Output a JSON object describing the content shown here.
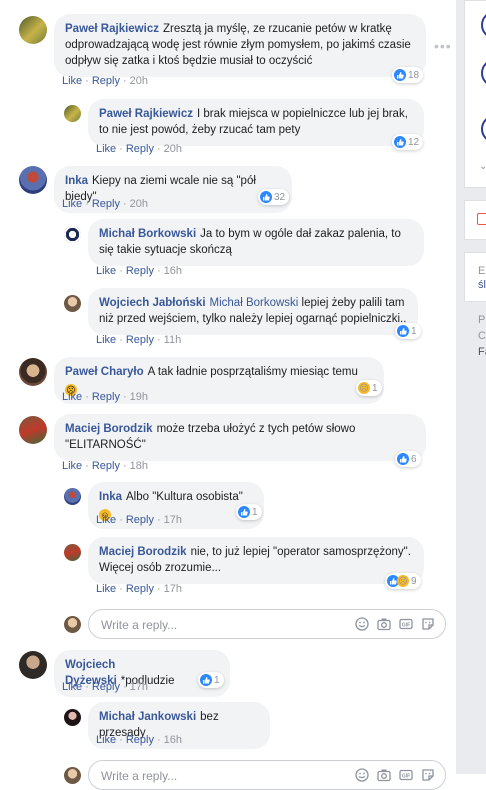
{
  "comments": [
    {
      "author": "Paweł Rajkiewicz",
      "text": "Zresztą ja myślę, ze rzucanie petów w kratkę odprowadzającą wodę jest równie złym pomysłem, po jakimś czasie odpływ się zatka i ktoś będzie musiał to oczyścić",
      "like": "Like",
      "reply": "Reply",
      "time": "20h",
      "count": "18"
    },
    {
      "author": "Paweł Rajkiewicz",
      "text": "I brak miejsca w popielniczce lub jej brak, to nie jest powód, żeby rzucać tam pety",
      "like": "Like",
      "reply": "Reply",
      "time": "20h",
      "count": "12"
    },
    {
      "author": "Inka",
      "text": "Kiepy na ziemi wcale nie są \"pół biedy\"",
      "like": "Like",
      "reply": "Reply",
      "time": "20h",
      "count": "32"
    },
    {
      "author": "Michał Borkowski",
      "text": "Ja to bym w ogóle dał zakaz palenia, to się takie sytuacje skończą",
      "like": "Like",
      "reply": "Reply",
      "time": "16h"
    },
    {
      "author": "Wojciech Jabłoński",
      "mention": "Michał Borkowski",
      "text": "lepiej żeby palili tam niż przed wejściem, tylko należy lepiej ogarnąć popielniczki..",
      "like": "Like",
      "reply": "Reply",
      "time": "11h",
      "count": "1"
    },
    {
      "author": "Paweł Charyło",
      "text": "A tak ładnie posprzątaliśmy miesiąc temu",
      "like": "Like",
      "reply": "Reply",
      "time": "19h",
      "count": "1"
    },
    {
      "author": "Maciej Borodzik",
      "text": "może trzeba ułożyć z tych petów słowo \"ELITARNOŚĆ\"",
      "like": "Like",
      "reply": "Reply",
      "time": "18h",
      "count": "6"
    },
    {
      "author": "Inka",
      "text": "Albo \"Kultura osobista\"",
      "like": "Like",
      "reply": "Reply",
      "time": "17h",
      "count": "1"
    },
    {
      "author": "Maciej Borodzik",
      "text": "nie, to już lepiej \"operator samosprzężony\". Więcej osób zrozumie...",
      "like": "Like",
      "reply": "Reply",
      "time": "17h",
      "count": "9"
    },
    {
      "author": "Wojciech Dyżewski",
      "text": "*podludzie",
      "like": "Like",
      "reply": "Reply",
      "time": "17h",
      "count": "1"
    },
    {
      "author": "Michał Jankowski",
      "text": "bez przesady",
      "like": "Like",
      "reply": "Reply",
      "time": "16h"
    }
  ],
  "reply_box": {
    "placeholder": "Write a reply..."
  },
  "sidebar": {
    "snippets": [
      "E",
      "śl",
      "P",
      "C",
      "Fa"
    ]
  },
  "colors": {
    "link": "#385898",
    "bubble": "#f2f3f5",
    "like_blue": "#2d88ff",
    "meta_gray": "#90949c"
  }
}
